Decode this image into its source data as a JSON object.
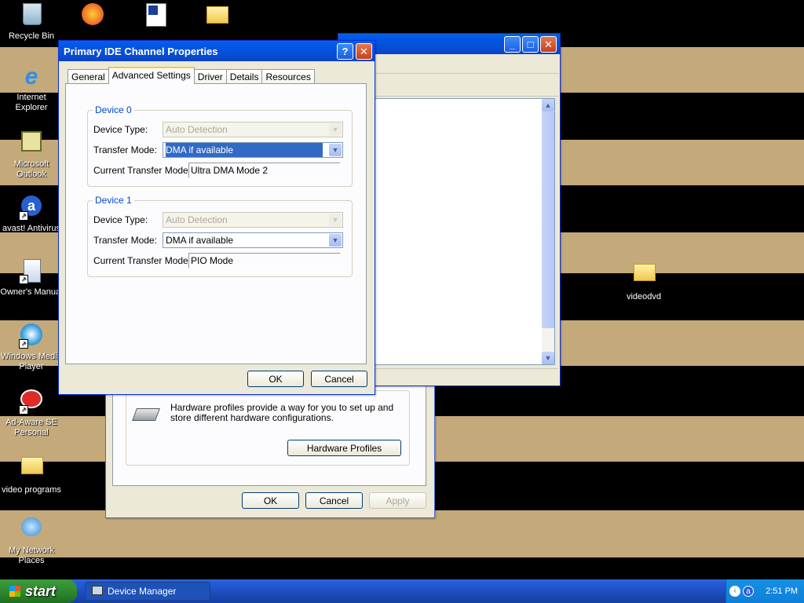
{
  "desktop": {
    "background_colors": {
      "black": "#000000",
      "tan": "#c4a97a"
    },
    "icons": [
      {
        "label": "Recycle Bin"
      },
      {
        "label": "Internet Explorer"
      },
      {
        "label": "Microsoft Outlook"
      },
      {
        "label": "avast! Antivirus"
      },
      {
        "label": "Owner's Manual"
      },
      {
        "label": "Windows Media Player"
      },
      {
        "label": "Ad-Aware SE Personal"
      },
      {
        "label": "video programs"
      },
      {
        "label": "My Network Places"
      },
      {
        "label": "videodvd"
      }
    ]
  },
  "system_properties": {
    "hardware_profiles_text": "Hardware profiles provide a way for you to set up and store different hardware configurations.",
    "hardware_profiles_button": "Hardware Profiles",
    "ok": "OK",
    "cancel": "Cancel",
    "apply": "Apply"
  },
  "dialog": {
    "title": "Primary IDE Channel Properties",
    "help_button": "?",
    "tabs": [
      {
        "label": "General"
      },
      {
        "label": "Advanced Settings"
      },
      {
        "label": "Driver"
      },
      {
        "label": "Details"
      },
      {
        "label": "Resources"
      }
    ],
    "device0": {
      "title": "Device 0",
      "device_type_label": "Device Type:",
      "device_type_value": "Auto Detection",
      "transfer_mode_label": "Transfer Mode:",
      "transfer_mode_value": "DMA if available",
      "current_mode_label": "Current Transfer Mode:",
      "current_mode_value": "Ultra DMA Mode 2"
    },
    "device1": {
      "title": "Device 1",
      "device_type_label": "Device Type:",
      "device_type_value": "Auto Detection",
      "transfer_mode_label": "Transfer Mode:",
      "transfer_mode_value": "DMA if available",
      "current_mode_label": "Current Transfer Mode:",
      "current_mode_value": "PIO Mode"
    },
    "ok": "OK",
    "cancel": "Cancel"
  },
  "taskbar": {
    "start": "start",
    "task": "Device Manager",
    "clock": "2:51 PM"
  }
}
